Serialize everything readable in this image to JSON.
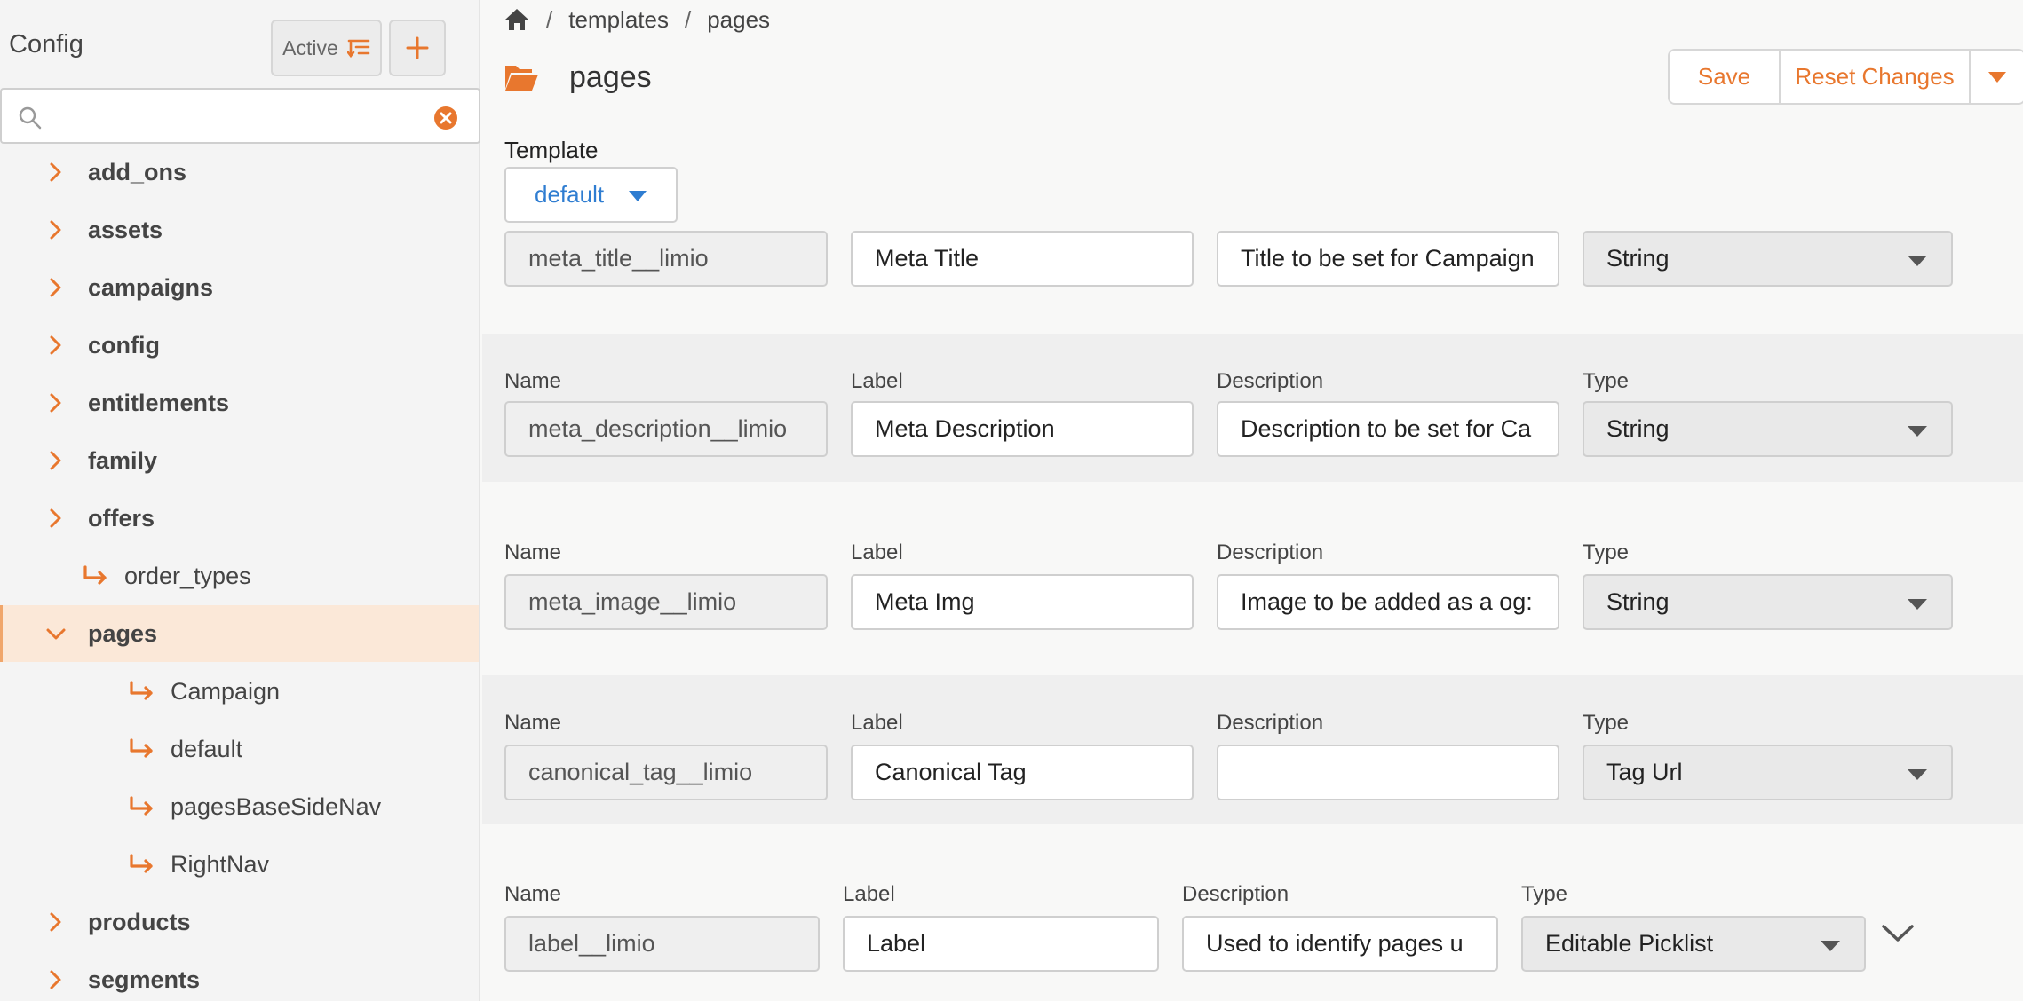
{
  "sidebar": {
    "title": "Config",
    "status_label": "Active",
    "search": {
      "value": "",
      "placeholder": ""
    },
    "items": [
      {
        "label": "add_ons"
      },
      {
        "label": "assets"
      },
      {
        "label": "campaigns"
      },
      {
        "label": "config"
      },
      {
        "label": "entitlements"
      },
      {
        "label": "family"
      },
      {
        "label": "offers"
      },
      {
        "label": "order_types"
      },
      {
        "label": "pages"
      },
      {
        "label": "Campaign"
      },
      {
        "label": "default"
      },
      {
        "label": "pagesBaseSideNav"
      },
      {
        "label": "RightNav"
      },
      {
        "label": "products"
      },
      {
        "label": "segments"
      }
    ]
  },
  "breadcrumb": {
    "home": "home-icon",
    "items": [
      "templates",
      "pages"
    ]
  },
  "page": {
    "title": "pages"
  },
  "toolbar": {
    "save_label": "Save",
    "reset_label": "Reset Changes"
  },
  "template": {
    "label": "Template",
    "selected": "default"
  },
  "field_labels": {
    "name": "Name",
    "label": "Label",
    "description": "Description",
    "type": "Type"
  },
  "fields": [
    {
      "name": "meta_title__limio",
      "label": "Meta Title",
      "description": "Title to be set for Campaign",
      "type": "String"
    },
    {
      "name": "meta_description__limio",
      "label": "Meta Description",
      "description": "Description to be set for Ca",
      "type": "String"
    },
    {
      "name": "meta_image__limio",
      "label": "Meta Img",
      "description": "Image to be added as a og:",
      "type": "String"
    },
    {
      "name": "canonical_tag__limio",
      "label": "Canonical Tag",
      "description": "",
      "type": "Tag Url"
    },
    {
      "name": "label__limio",
      "label": "Label",
      "description": "Used to identify pages u",
      "type": "Editable Picklist"
    }
  ],
  "colors": {
    "accent": "#e8772e",
    "link": "#2f7dd1",
    "selected_bg": "#fbe8d8"
  }
}
